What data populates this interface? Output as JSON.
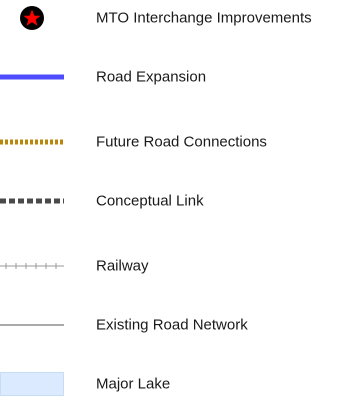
{
  "legend": {
    "items": [
      {
        "label": "MTO Interchange Improvements",
        "symbol": "red-star-in-black-circle-icon",
        "color": "#ff0000"
      },
      {
        "label": "Road Expansion",
        "symbol": "solid-blue-line",
        "color": "#4d4dff"
      },
      {
        "label": "Future Road Connections",
        "symbol": "gold-dashed-line",
        "color": "#b8860b"
      },
      {
        "label": "Conceptual Link",
        "symbol": "dark-gray-dashed-line",
        "color": "#4a4a4a"
      },
      {
        "label": "Railway",
        "symbol": "railway-line",
        "color": "#9a9a9a"
      },
      {
        "label": "Existing Road Network",
        "symbol": "thin-gray-line",
        "color": "#555555"
      },
      {
        "label": "Major Lake",
        "symbol": "light-blue-box",
        "color": "#dbeaff"
      }
    ]
  }
}
